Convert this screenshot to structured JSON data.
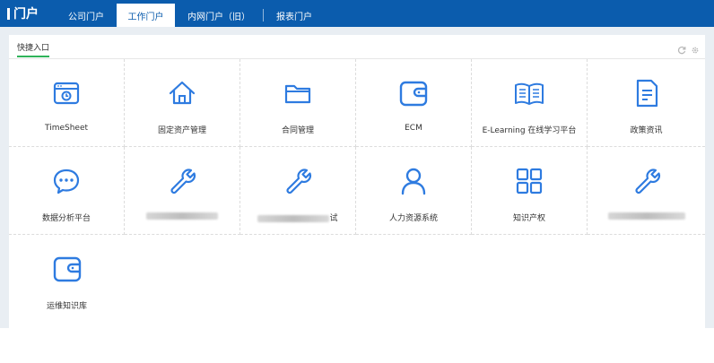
{
  "header": {
    "brand": "门户",
    "tabs": [
      {
        "label": "公司门户",
        "active": false
      },
      {
        "label": "工作门户",
        "active": true
      },
      {
        "label": "内网门户（旧）",
        "active": false
      },
      {
        "label": "报表门户",
        "active": false
      }
    ]
  },
  "card": {
    "title": "快捷入口",
    "tools": [
      "refresh-icon",
      "gear-icon"
    ]
  },
  "colors": {
    "header": "#0b5cad",
    "icon": "#2e7be0",
    "underline": "#2fb35a"
  },
  "items": [
    {
      "label": "TimeSheet",
      "icon": "timesheet-icon"
    },
    {
      "label": "固定资产管理",
      "icon": "home-icon"
    },
    {
      "label": "合同管理",
      "icon": "folder-icon"
    },
    {
      "label": "ECM",
      "icon": "wallet-icon"
    },
    {
      "label": "E-Learning 在线学习平台",
      "icon": "book-icon"
    },
    {
      "label": "政策资讯",
      "icon": "document-icon"
    },
    {
      "label": "数据分析平台",
      "icon": "chat-icon"
    },
    {
      "label": "",
      "icon": "wrench-icon",
      "redacted": true
    },
    {
      "label": "试",
      "icon": "wrench-icon",
      "redacted": true
    },
    {
      "label": "人力资源系统",
      "icon": "user-icon"
    },
    {
      "label": "知识产权",
      "icon": "grid-icon"
    },
    {
      "label": "",
      "icon": "wrench-icon",
      "redacted": true
    },
    {
      "label": "运维知识库",
      "icon": "wallet-icon"
    }
  ]
}
